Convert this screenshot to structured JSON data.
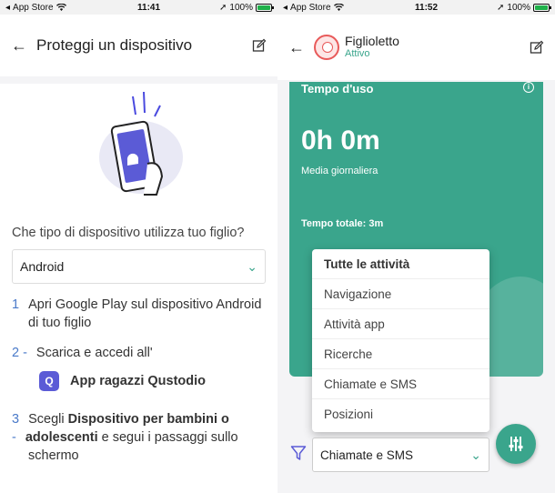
{
  "left": {
    "statusbar": {
      "carrier": "App Store",
      "time": "11:41",
      "battery": "100%"
    },
    "header": {
      "title": "Proteggi un dispositivo"
    },
    "question": "Che tipo di dispositivo utilizza tuo figlio?",
    "device_select": {
      "value": "Android"
    },
    "steps": [
      {
        "num": "1",
        "text": "Apri Google Play sul dispositivo Android",
        "text2": "di tuo figlio"
      },
      {
        "num": "2 -",
        "text": "Scarica e accedi all'"
      },
      {
        "num": "3",
        "num2": "-",
        "pre": "Scegli ",
        "bold": "Dispositivo per bambini o",
        "bold2": "adolescenti",
        "post": " e segui i passaggi sullo",
        "post2": "schermo"
      }
    ],
    "app": {
      "name": "App ragazzi Qustodio",
      "icon_letter": "Q"
    }
  },
  "right": {
    "statusbar": {
      "carrier": "App Store",
      "time": "11:52",
      "battery": "100%"
    },
    "header": {
      "name": "Figlioletto",
      "status": "Attivo"
    },
    "card": {
      "title": "Tempo d'uso",
      "big": "0h 0m",
      "avg": "Media giornaliera",
      "total": "Tempo totale: 3m"
    },
    "menu": [
      "Tutte le attività",
      "Navigazione",
      "Attività app",
      "Ricerche",
      "Chiamate e SMS",
      "Posizioni"
    ],
    "filter_select": {
      "value": "Chiamate e SMS"
    }
  },
  "colors": {
    "accent": "#3aa58c",
    "step_number": "#4a7ac9",
    "app_icon": "#5b5bd6"
  },
  "icons": [
    "back-arrow-icon",
    "edit-icon",
    "info-icon",
    "filter-icon",
    "sliders-icon",
    "chevron-down-icon",
    "wifi-icon",
    "battery-icon"
  ]
}
